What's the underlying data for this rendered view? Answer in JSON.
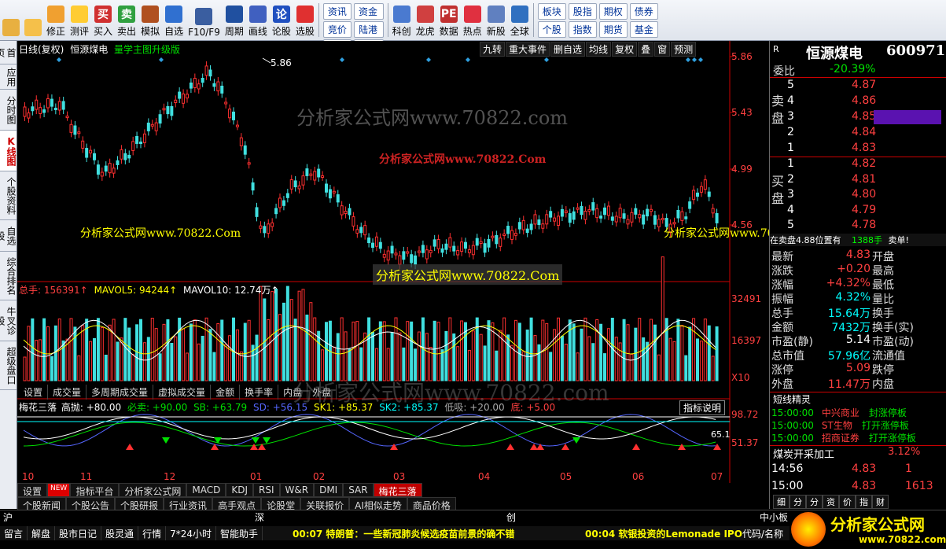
{
  "toolbar": {
    "buttons": [
      {
        "label": "",
        "icon": "grid-icon"
      },
      {
        "label": "",
        "icon": "back-arrow-icon"
      },
      {
        "label": "修正",
        "icon": "up-arrow-icon"
      },
      {
        "label": "测评",
        "icon": "clock-icon"
      },
      {
        "label": "买入",
        "icon": "buy-icon",
        "glyph": "买"
      },
      {
        "label": "卖出",
        "icon": "sell-icon",
        "glyph": "卖"
      },
      {
        "label": "模拟",
        "icon": "hammer-icon"
      },
      {
        "label": "自选",
        "icon": "star-icon"
      },
      {
        "label": "F10/F9",
        "icon": "f10-icon"
      },
      {
        "label": "周期",
        "icon": "cycle-icon"
      },
      {
        "label": "画线",
        "icon": "pen-icon"
      },
      {
        "label": "论股",
        "icon": "chat-icon",
        "glyph": "论"
      },
      {
        "label": "选股",
        "icon": "gauge-icon"
      }
    ],
    "grid1": [
      "资讯",
      "资金",
      "竞价",
      "陆港",
      "研报",
      "BBD",
      "预测",
      "沪伦"
    ],
    "buttons2": [
      {
        "label": "科创",
        "icon": "chart-icon"
      },
      {
        "label": "龙虎",
        "icon": "dragon-icon"
      },
      {
        "label": "数据",
        "icon": "pe-icon",
        "glyph": "PE"
      },
      {
        "label": "热点",
        "icon": "hot-icon"
      },
      {
        "label": "新股",
        "icon": "ipo-icon"
      },
      {
        "label": "全球",
        "icon": "globe-icon"
      }
    ],
    "grid2": [
      "板块",
      "股指",
      "期权",
      "债券",
      "个股",
      "指数",
      "期货",
      "基金"
    ]
  },
  "sidebar": [
    "首页",
    "应用",
    "分时图",
    "K线图",
    "个股资料",
    "自选股",
    "综合排名",
    "牛叉诊股",
    "超级盘口"
  ],
  "chart": {
    "title": "日线(复权)",
    "stock_name": "恒源煤电",
    "upgrade": "量学主图升级版",
    "menu": [
      "九转",
      "重大事件",
      "删自选",
      "均线",
      "复权",
      "叠",
      "窗",
      "预测"
    ],
    "price_ticks": [
      "5.86",
      "5.43",
      "4.99",
      "4.56"
    ],
    "high_label": "5.86",
    "vol_header": {
      "total": "总手: 156391↑",
      "ma5": "MAVOL5: 94244↑",
      "ma10": "MAVOL10: 12.74万↑"
    },
    "vol_ticks": [
      "32491",
      "16397",
      "X10"
    ],
    "vol_tabs": [
      "设置",
      "成交量",
      "多周期成交量",
      "虚拟成交量",
      "金额",
      "换手率",
      "内盘",
      "外盘"
    ],
    "ind_header": {
      "name": "梅花三落",
      "high": "高抛: +80.00",
      "must_sell": "必卖: +90.00",
      "sb": "SB: +63.79",
      "sd": "SD: +56.15",
      "sk1": "SK1: +85.37",
      "sk2": "SK2: +85.37",
      "low": "低吸: +20.00",
      "bottom": "底: +5.00"
    },
    "ind_button": "指标说明",
    "ind_ticks": [
      "98.72",
      "51.37"
    ],
    "ind_side": "65.1",
    "months": [
      "10",
      "11",
      "12",
      "01",
      "02",
      "03",
      "04",
      "05",
      "06",
      "07"
    ],
    "watermarks": [
      "分析家公式网www.70822.com",
      "分析家公式网www.70822.Com",
      "分析家公式网www.70822.Com",
      "分析家公式网www.70822.Com",
      "分析家公式网www.70822.Com",
      "分析家公式网www.70822.com"
    ]
  },
  "bottom_tabs": {
    "row1": [
      "设置",
      "NEW",
      "指标平台",
      "分析家公式网",
      "MACD",
      "KDJ",
      "RSI",
      "W&R",
      "DMI",
      "SAR",
      "梅花三落"
    ],
    "row2": [
      "个股新闻",
      "个股公告",
      "个股研报",
      "行业资讯",
      "高手观点",
      "论股堂",
      "关联报价",
      "AI相似走势",
      "商品价格"
    ]
  },
  "right": {
    "stock_name": "恒源煤电",
    "code": "600971",
    "weibi_label": "委比",
    "weibi": "-20.39%",
    "sell": [
      {
        "n": "5",
        "p": "4.87"
      },
      {
        "n": "4",
        "p": "4.86"
      },
      {
        "n": "3",
        "p": "4.85"
      },
      {
        "n": "2",
        "p": "4.84"
      },
      {
        "n": "1",
        "p": "4.83"
      }
    ],
    "buy": [
      {
        "n": "1",
        "p": "4.82"
      },
      {
        "n": "2",
        "p": "4.81"
      },
      {
        "n": "3",
        "p": "4.80"
      },
      {
        "n": "4",
        "p": "4.79"
      },
      {
        "n": "5",
        "p": "4.78"
      }
    ],
    "sell_label": "卖盘",
    "buy_label": "买盘",
    "ticker": "在卖盘4.88位置有",
    "ticker_qty": "1388手",
    "ticker_tag": "卖单!",
    "quotes": [
      {
        "l": "最新",
        "v": "4.83",
        "l2": "开盘"
      },
      {
        "l": "涨跌",
        "v": "+0.20",
        "l2": "最高"
      },
      {
        "l": "涨幅",
        "v": "+4.32%",
        "l2": "最低"
      },
      {
        "l": "振幅",
        "v": "4.32%",
        "l2": "量比"
      },
      {
        "l": "总手",
        "v": "15.64万",
        "l2": "换手"
      },
      {
        "l": "金额",
        "v": "7432万",
        "l2": "换手(实)"
      },
      {
        "l": "市盈(静)",
        "v": "5.14",
        "l2": "市盈(动)"
      },
      {
        "l": "总市值",
        "v": "57.96亿",
        "l2": "流通值"
      },
      {
        "l": "涨停",
        "v": "5.09",
        "l2": "跌停"
      },
      {
        "l": "外盘",
        "v": "11.47万",
        "l2": "内盘"
      }
    ],
    "short_title": "短线精灵",
    "short": [
      {
        "t": "15:00:00",
        "s": "中兴商业",
        "e": "封涨停板"
      },
      {
        "t": "15:00:00",
        "s": "ST生物",
        "e": "打开涨停板"
      },
      {
        "t": "15:00:00",
        "s": "招商证券",
        "e": "打开涨停板"
      }
    ],
    "sector": "煤炭开采加工",
    "sector_pct": "3.12%",
    "ticks": [
      {
        "t": "14:56",
        "p": "4.83",
        "q": "1"
      },
      {
        "t": "15:00",
        "p": "4.83",
        "q": "1613"
      }
    ],
    "rtabs": [
      "细",
      "分",
      "分",
      "资",
      "价",
      "指",
      "财"
    ]
  },
  "status": {
    "idx": [
      "沪",
      "深",
      "创",
      "中小板"
    ],
    "bottom": [
      "留言",
      "解盘",
      "股市日记",
      "股灵通",
      "行情",
      "7*24小时",
      "智能助手"
    ],
    "news1": "00:07 特朗普：一些新冠肺炎候选疫苗前景的确不错",
    "news2": "00:04 软银投资的Lemonade IPO",
    "code_hint": "代码/名称",
    "logo": "分析家公式网",
    "logo_url": "www.70822.com"
  }
}
